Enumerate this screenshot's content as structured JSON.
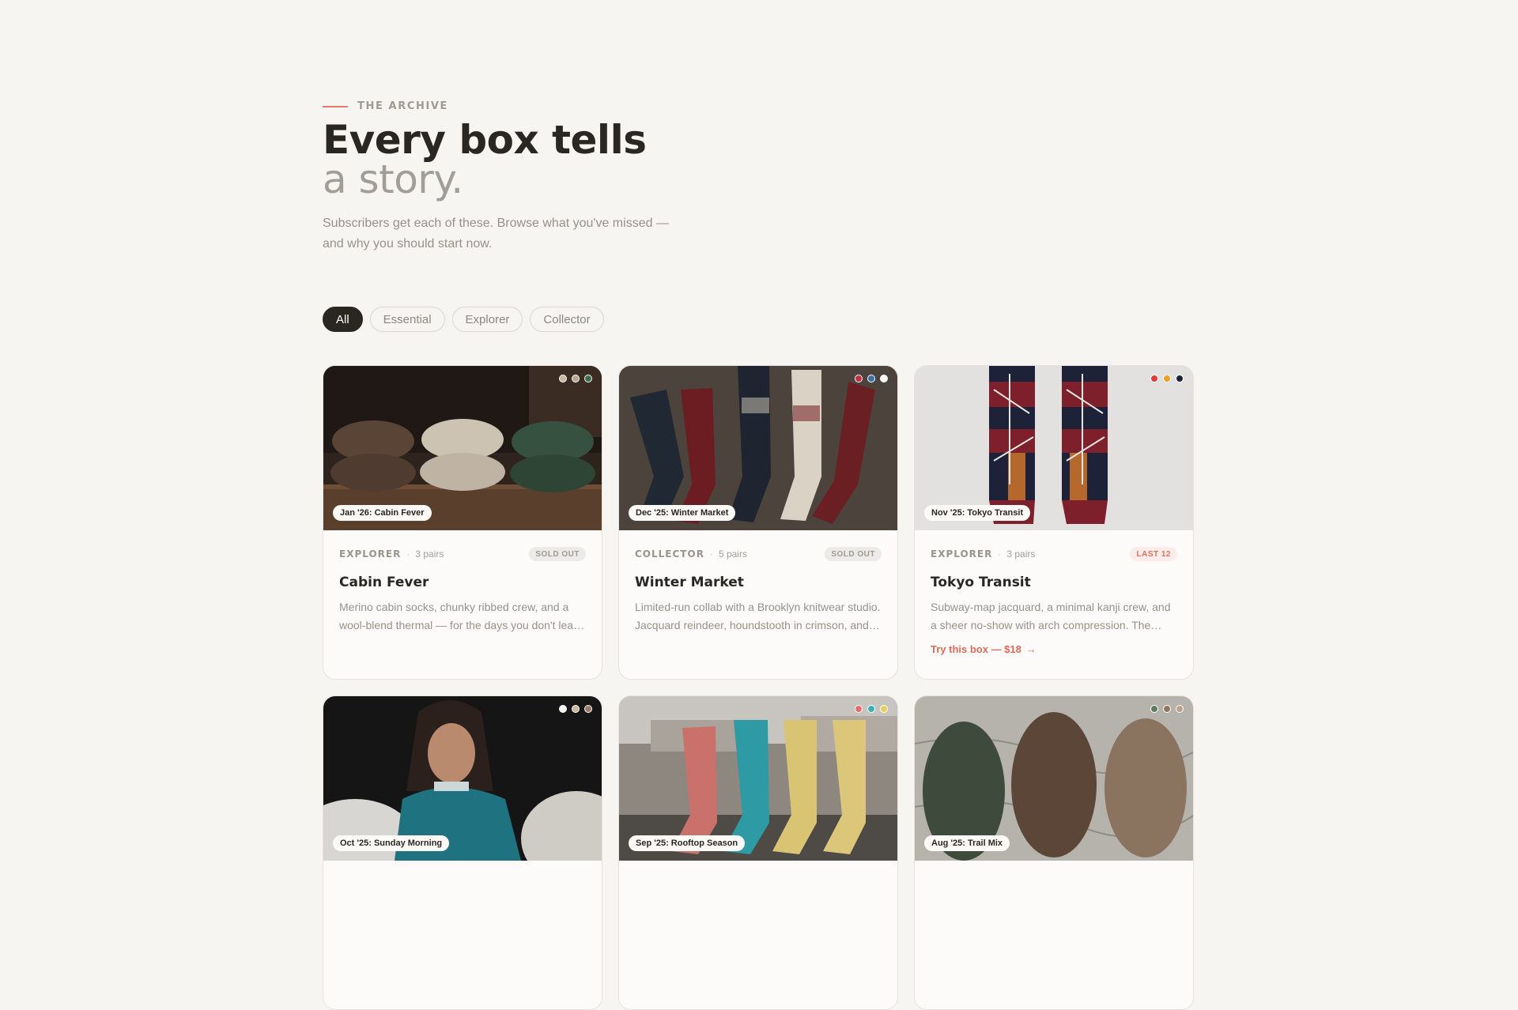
{
  "header": {
    "eyebrow": "THE ARCHIVE",
    "title_line1": "Every box tells",
    "title_line2": "a story.",
    "lede": "Subscribers get each of these. Browse what you've missed — and why you should start now."
  },
  "filters": [
    {
      "label": "All",
      "active": true
    },
    {
      "label": "Essential",
      "active": false
    },
    {
      "label": "Explorer",
      "active": false
    },
    {
      "label": "Collector",
      "active": false
    }
  ],
  "boxes": [
    {
      "tag": "Jan '26: Cabin Fever",
      "tier": "EXPLORER",
      "pairs": "3 pairs",
      "badge": "SOLD OUT",
      "title": "Cabin Fever",
      "desc": "Merino cabin socks, chunky ribbed crew, and a wool-blend thermal — for the days you don't leave the house.",
      "dots": [
        "#c9b79a",
        "#b9a48a",
        "#3f6b4f"
      ],
      "cta": ""
    },
    {
      "tag": "Dec '25: Winter Market",
      "tier": "COLLECTOR",
      "pairs": "5 pairs",
      "badge": "SOLD OUT",
      "title": "Winter Market",
      "desc": "Limited-run collab with a Brooklyn knitwear studio. Jacquard reindeer, houndstooth in crimson, and more.",
      "dots": [
        "#c3303f",
        "#3d6fa8",
        "#ffffff"
      ],
      "cta": ""
    },
    {
      "tag": "Nov '25: Tokyo Transit",
      "tier": "EXPLORER",
      "pairs": "3 pairs",
      "badge": "LAST 12",
      "title": "Tokyo Transit",
      "desc": "Subway-map jacquard, a minimal kanji crew, and a sheer no-show with arch compression. The commute, upgraded.",
      "dots": [
        "#e03a3a",
        "#f0a020",
        "#1e2233"
      ],
      "cta": "Try this box — $18"
    },
    {
      "tag": "Oct '25: Sunday Morning",
      "dots": [
        "#f5f3ef",
        "#c8b89c",
        "#9c7a66"
      ]
    },
    {
      "tag": "Sep '25: Rooftop Season",
      "dots": [
        "#e86a6a",
        "#3ab0b0",
        "#e8cf5a"
      ]
    },
    {
      "tag": "Aug '25: Trail Mix",
      "dots": [
        "#5d7b5a",
        "#8e7560",
        "#b9a48a"
      ]
    }
  ]
}
